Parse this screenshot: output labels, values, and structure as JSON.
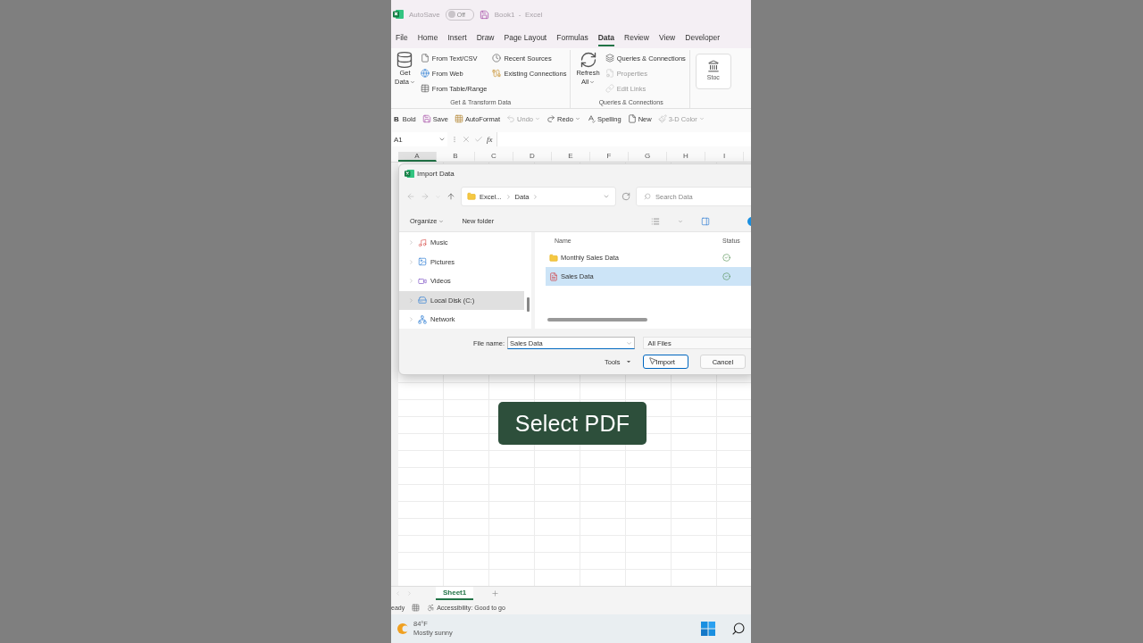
{
  "title_bar": {
    "autosave_label": "AutoSave",
    "autosave_toggle": {
      "label": "Off",
      "on": false
    },
    "document_title": "Book1  -  Excel"
  },
  "menu_tabs": [
    {
      "label": "File",
      "selected": false
    },
    {
      "label": "Home",
      "selected": false
    },
    {
      "label": "Insert",
      "selected": false
    },
    {
      "label": "Draw",
      "selected": false
    },
    {
      "label": "Page Layout",
      "selected": false
    },
    {
      "label": "Formulas",
      "selected": false
    },
    {
      "label": "Data",
      "selected": true
    },
    {
      "label": "Review",
      "selected": false
    },
    {
      "label": "View",
      "selected": false
    },
    {
      "label": "Developer",
      "selected": false
    }
  ],
  "ribbon": {
    "get_data": [
      "Get",
      "Data"
    ],
    "transform_items": [
      {
        "label": "From Text/CSV",
        "kind": "text-file",
        "disabled": false
      },
      {
        "label": "From Web",
        "kind": "web",
        "disabled": false
      },
      {
        "label": "From Table/Range",
        "kind": "table",
        "disabled": false
      }
    ],
    "source_items": [
      {
        "label": "Recent Sources",
        "kind": "recent",
        "disabled": false
      },
      {
        "label": "Existing Connections",
        "kind": "connections",
        "disabled": false
      }
    ],
    "group_1_title": "Get & Transform Data",
    "refresh_all": [
      "Refresh",
      "All"
    ],
    "query_items": [
      {
        "label": "Queries & Connections",
        "kind": "queries",
        "disabled": false
      },
      {
        "label": "Properties",
        "kind": "properties",
        "disabled": true
      },
      {
        "label": "Edit Links",
        "kind": "links",
        "disabled": true
      }
    ],
    "group_2_title": "Queries & Connections",
    "stocks_label": "Stoc"
  },
  "quick_access": [
    {
      "kind": "bold",
      "glyph": "B",
      "label": "Bold",
      "disabled": false,
      "has_menu": false
    },
    {
      "kind": "save",
      "label": "Save",
      "disabled": false,
      "has_menu": false
    },
    {
      "kind": "autoformat",
      "label": "AutoFormat",
      "disabled": false,
      "has_menu": false
    },
    {
      "kind": "undo",
      "label": "Undo",
      "disabled": true,
      "has_menu": true
    },
    {
      "kind": "redo",
      "label": "Redo",
      "disabled": false,
      "has_menu": true
    },
    {
      "kind": "spelling",
      "label": "Spelling",
      "disabled": false,
      "has_menu": false
    },
    {
      "kind": "new",
      "label": "New",
      "disabled": false,
      "has_menu": false
    },
    {
      "kind": "color",
      "label": "3-D Color",
      "disabled": true,
      "has_menu": true
    }
  ],
  "formula_bar": {
    "name_box": "A1",
    "fx": "fx"
  },
  "columns": [
    {
      "label": "A",
      "selected": true
    },
    {
      "label": "B",
      "selected": false
    },
    {
      "label": "C",
      "selected": false
    },
    {
      "label": "D",
      "selected": false
    },
    {
      "label": "E",
      "selected": false
    },
    {
      "label": "F",
      "selected": false
    },
    {
      "label": "G",
      "selected": false
    },
    {
      "label": "H",
      "selected": false
    },
    {
      "label": "I",
      "selected": false
    }
  ],
  "dialog": {
    "title": "Import Data",
    "breadcrumb": [
      "Excel...",
      "Data"
    ],
    "search_placeholder": "Search Data",
    "toolbar": [
      {
        "label": "Organize",
        "has_menu": true
      },
      {
        "label": "New folder",
        "has_menu": false
      }
    ],
    "nav_items": [
      {
        "label": "Music",
        "kind": "music",
        "selected": false
      },
      {
        "label": "Pictures",
        "kind": "pictures",
        "selected": false
      },
      {
        "label": "Videos",
        "kind": "videos",
        "selected": false
      },
      {
        "label": "Local Disk (C:)",
        "kind": "disk",
        "selected": true
      },
      {
        "label": "Network",
        "kind": "network",
        "selected": false
      }
    ],
    "columns": [
      "Name",
      "Status"
    ],
    "files": [
      {
        "name": "Monthly Sales Data",
        "kind": "folder",
        "selected": false
      },
      {
        "name": "Sales Data",
        "kind": "pdf",
        "selected": true
      }
    ],
    "file_name_label": "File name:",
    "file_name_value": "Sales Data",
    "file_type": "All Files",
    "tools": "Tools",
    "buttons": [
      {
        "label": "Import",
        "primary": true
      },
      {
        "label": "Cancel",
        "primary": false
      }
    ]
  },
  "caption": "Select PDF",
  "sheet_tabs": [
    {
      "label": "Sheet1",
      "selected": true
    }
  ],
  "status_bar": {
    "mode": "eady",
    "accessibility": "Accessibility: Good to go"
  },
  "taskbar": {
    "temperature": "84°F",
    "condition": "Mostly sunny"
  }
}
